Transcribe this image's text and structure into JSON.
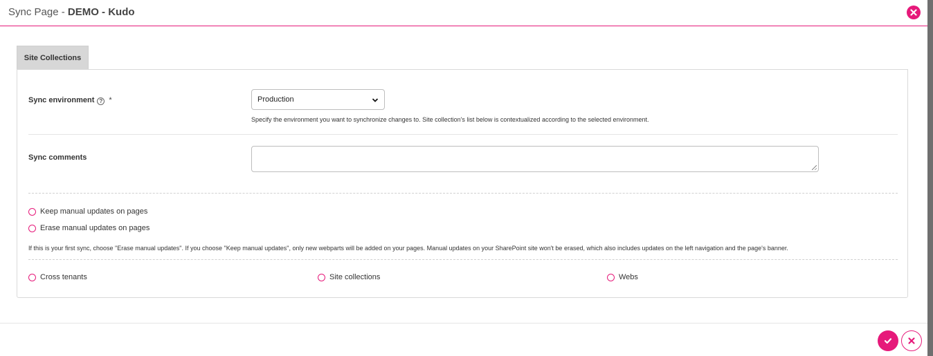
{
  "dialog": {
    "title_prefix": "Sync Page - ",
    "title_bold": "DEMO - Kudo"
  },
  "tabs": [
    {
      "label": "Site Collections"
    }
  ],
  "form": {
    "sync_environment": {
      "label": "Sync environment",
      "required_mark": "*",
      "selected": "Production",
      "hint": "Specify the environment you want to synchronize changes to. Site collection's list below is contextualized according to the selected environment."
    },
    "sync_comments": {
      "label": "Sync comments",
      "value": ""
    },
    "update_options": [
      {
        "label": "Keep manual updates on pages"
      },
      {
        "label": "Erase manual updates on pages"
      }
    ],
    "note": "If this is your first sync, choose \"Erase manual updates\". If you choose \"Keep manual updates\", only new webparts will be added on your pages. Manual updates on your SharePoint site won't be erased, which also includes updates on the left navigation and the page's banner.",
    "scope_options": [
      {
        "label": "Cross tenants"
      },
      {
        "label": "Site collections"
      },
      {
        "label": "Webs"
      }
    ]
  },
  "icons": {
    "close": "close-icon",
    "help": "help-icon",
    "confirm": "check-icon",
    "cancel": "close-icon"
  },
  "colors": {
    "accent": "#e6197a"
  }
}
